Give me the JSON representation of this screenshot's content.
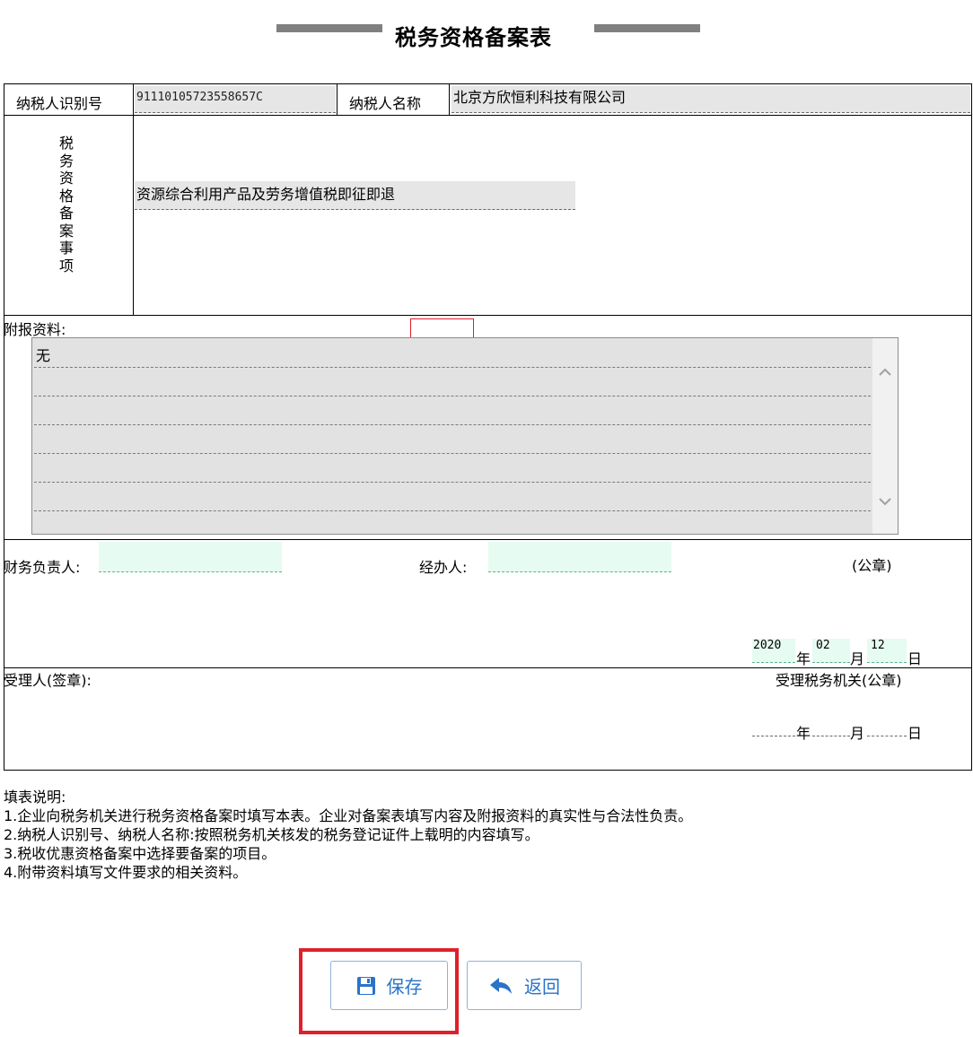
{
  "title": "税务资格备案表",
  "header_row": {
    "id_label": "纳税人识别号",
    "id_value": "91110105723558657C",
    "name_label": "纳税人名称",
    "name_value": "北京方欣恒利科技有限公司"
  },
  "matter": {
    "label_chars": [
      "税",
      "务",
      "资",
      "格",
      "备",
      "案",
      "事",
      "项"
    ],
    "value": "资源综合利用产品及劳务增值税即征即退"
  },
  "attachments": {
    "label": "附报资料:",
    "value": "无"
  },
  "signers": {
    "finance_label": "财务负责人:",
    "finance_value": "",
    "handler_label": "经办人:",
    "handler_value": "",
    "seal": "(公章)",
    "year": "2020",
    "year_label": "年",
    "month": "02",
    "month_label": "月",
    "day": "12",
    "day_label": "日"
  },
  "acceptance": {
    "receiver_label": "受理人(签章):",
    "office_label": "受理税务机关(公章)",
    "year_label": "年",
    "month_label": "月",
    "day_label": "日"
  },
  "notes": {
    "heading": "填表说明:",
    "items": [
      "1.企业向税务机关进行税务资格备案时填写本表。企业对备案表填写内容及附报资料的真实性与合法性负责。",
      "2.纳税人识别号、纳税人名称:按照税务机关核发的税务登记证件上载明的内容填写。",
      "3.税收优惠资格备案中选择要备案的项目。",
      "4.附带资料填写文件要求的相关资料。"
    ]
  },
  "buttons": {
    "save": "保存",
    "back": "返回"
  },
  "icons": {
    "save": "floppy-disk-icon",
    "back": "reply-arrow-icon",
    "scroll_up": "chevron-up-icon",
    "scroll_down": "chevron-down-icon"
  },
  "colors": {
    "button_text": "#2a73c8",
    "highlight": "#e0202a"
  }
}
